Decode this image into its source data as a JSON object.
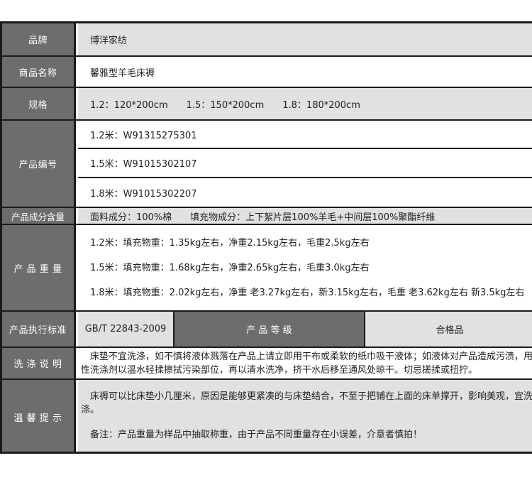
{
  "rows": {
    "brand": {
      "label": "品牌",
      "value": "博洋家纺"
    },
    "name": {
      "label": "商品名称",
      "value": "馨雅型羊毛床褥"
    },
    "spec": {
      "label": "规格",
      "values": [
        "1.2：120*200cm",
        "1.5：150*200cm",
        "1.8：180*200cm"
      ]
    },
    "code": {
      "label": "产品编号",
      "values": [
        "1.2米：W91315275301",
        "1.5米：W91015302107",
        "1.8米：W91015302207"
      ]
    },
    "composition": {
      "label": "产品成分含量",
      "fabric": "面料成分：100%棉",
      "filling": "填充物成分：上下絮片层100%羊毛+中间层100%聚酯纤维"
    },
    "weight": {
      "label": "产 品 重 量",
      "values": [
        "1.2米：填充物重：1.35kg左右，净重2.15kg左右，毛重2.5kg左右",
        "1.5米：填充物重：1.68kg左右，净重2.65kg左右，毛重3.0kg左右",
        "1.8米：填充物重：2.02kg左右，净重 老3.27kg左右，新3.15kg左右，毛重 老3.62kg左右 新3.5kg左右"
      ]
    },
    "standard": {
      "label": "产品执行标准",
      "value": "GB/T 22843-2009",
      "grade_label": "产 品 等 级",
      "grade_value": "合格品"
    },
    "wash": {
      "label": "洗 涤 说 明",
      "value": "　床垫不宜洗涤，如不慎将液体溅落在产品上请立即用干布或柔软的纸巾吸干液体；如液体对产品造成污渍，用中性洗涤剂以温水轻揉擦拭污染部位，再以清水洗净，挤干水后移至通风处晾干。切忌搓揉或扭拧。"
    },
    "tips": {
      "label": "温 馨 提 示",
      "line1": "　床褥可以比床垫小几厘米，原因是能够更紧凑的与床垫结合，不至于把铺在上面的床单撑开，影响美观，宜洗涤。",
      "line2": "　备注：产品重量为样品中抽取称重，由于产品不同重量存在小误差，介意者慎拍！"
    }
  }
}
